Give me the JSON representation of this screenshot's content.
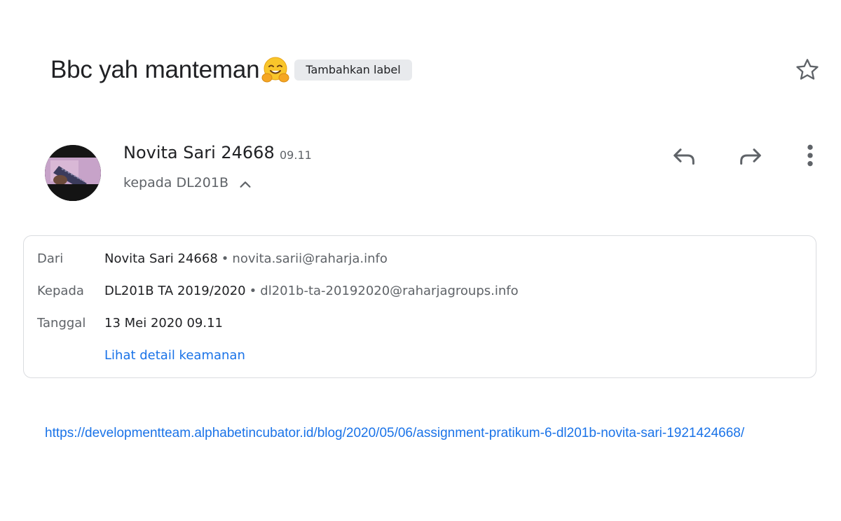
{
  "subject": {
    "title": "Bbc yah manteman",
    "emoji_icon": "hugging-face-emoji",
    "label_chip": "Tambahkan label"
  },
  "star": {
    "icon": "star-outline-icon",
    "starred": false
  },
  "sender": {
    "name": "Novita Sari 24668",
    "time": "09.11",
    "recipient_summary": "kepada DL201B",
    "expand_icon": "chevron-up-icon"
  },
  "actions": {
    "reply_icon": "reply-icon",
    "forward_icon": "forward-icon",
    "more_icon": "more-vert-icon"
  },
  "details": {
    "from": {
      "label": "Dari",
      "name": "Novita Sari 24668",
      "separator": "•",
      "email": "novita.sarii@raharja.info"
    },
    "to": {
      "label": "Kepada",
      "name": "DL201B TA 2019/2020",
      "separator": "•",
      "email": "dl201b-ta-20192020@raharjagroups.info"
    },
    "date": {
      "label": "Tanggal",
      "value": "13 Mei 2020 09.11"
    },
    "security_link": "Lihat detail keamanan"
  },
  "body": {
    "link": "https://developmentteam.alphabetincubator.id/blog/2020/05/06/assignment-pratikum-6-dl201b-novita-sari-1921424668/"
  },
  "colors": {
    "text_primary": "#202124",
    "text_secondary": "#5f6368",
    "link": "#1a73e8",
    "chip_bg": "#e8eaed",
    "border": "#dadce0"
  }
}
